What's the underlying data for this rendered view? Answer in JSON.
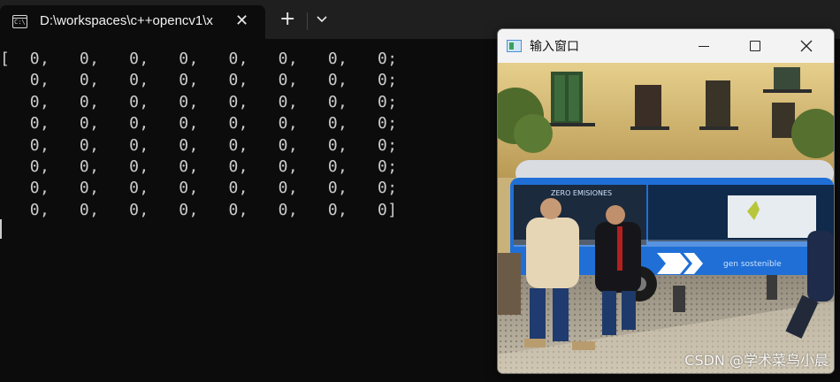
{
  "terminal": {
    "tab_title": "D:\\workspaces\\c++opencv1\\x",
    "tab_close_glyph": "✕",
    "new_tab_glyph": "+",
    "output_lines": [
      "[  0,   0,   0,   0,   0,   0,   0,   0;",
      "   0,   0,   0,   0,   0,   0,   0,   0;",
      "   0,   0,   0,   0,   0,   0,   0,   0;",
      "   0,   0,   0,   0,   0,   0,   0,   0;",
      "   0,   0,   0,   0,   0,   0,   0,   0;",
      "   0,   0,   0,   0,   0,   0,   0,   0;",
      "   0,   0,   0,   0,   0,   0,   0,   0;",
      "   0,   0,   0,   0,   0,   0,   0,   0]"
    ]
  },
  "image_window": {
    "title": "输入窗口",
    "watermark": "CSDN @学术菜鸟小晨",
    "bus_sign": "gen sostenible",
    "bus_top_text": "ZERO EMISIONES"
  },
  "icons": {
    "tab": "terminal-icon",
    "close": "close-icon",
    "new_tab": "plus-icon",
    "dropdown": "chevron-down-icon",
    "window_app": "opencv-window-icon",
    "minimize": "minimize-icon",
    "maximize": "maximize-icon",
    "window_close": "window-close-icon"
  },
  "colors": {
    "terminal_bg": "#0c0c0c",
    "tabbar_bg": "#1f1f1f",
    "text": "#cccccc",
    "bus_blue": "#1f6fd6"
  }
}
